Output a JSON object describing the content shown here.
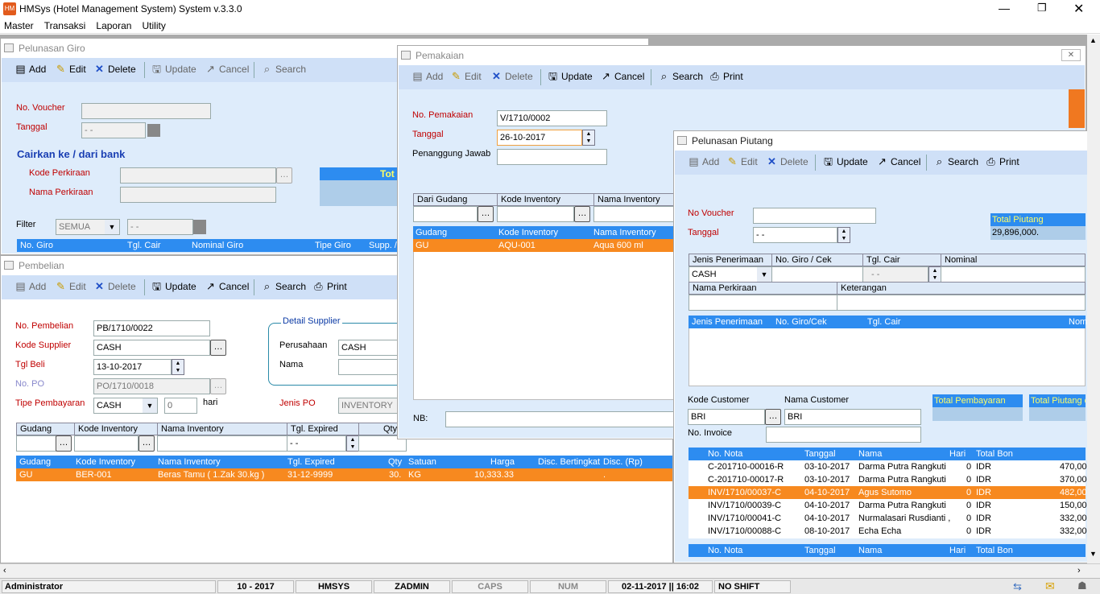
{
  "app": {
    "title": "HMSys (Hotel Management System) System v.3.3.0",
    "menu": [
      "Master",
      "Transaksi",
      "Laporan",
      "Utility"
    ]
  },
  "toolbar_common": {
    "add": "Add",
    "edit": "Edit",
    "delete": "Delete",
    "update": "Update",
    "cancel": "Cancel",
    "search": "Search",
    "print": "Print"
  },
  "giro": {
    "title": "Pelunasan Giro",
    "no_voucher_label": "No. Voucher",
    "tanggal_label": "Tanggal",
    "tanggal_value": "- -",
    "section": "Cairkan ke / dari bank",
    "kode_perkiraan_label": "Kode Perkiraan",
    "nama_perkiraan_label": "Nama Perkiraan",
    "tot_label": "Tot",
    "filter_label": "Filter",
    "filter_value": "SEMUA",
    "filter_date": "- -",
    "columns": [
      "No. Giro",
      "Tgl. Cair",
      "Nominal Giro",
      "Tipe Giro",
      "Supp. /"
    ]
  },
  "pembelian": {
    "title": "Pembelian",
    "no_pembelian_label": "No. Pembelian",
    "no_pembelian": "PB/1710/0022",
    "kode_supplier_label": "Kode Supplier",
    "kode_supplier": "CASH",
    "tgl_beli_label": "Tgl Beli",
    "tgl_beli": "13-10-2017",
    "no_po_label": "No. PO",
    "no_po": "PO/1710/0018",
    "tipe_bayar_label": "Tipe Pembayaran",
    "tipe_bayar": "CASH",
    "hari_value": "0",
    "hari_label": "hari",
    "detail_supplier": "Detail Supplier",
    "perusahaan_label": "Perusahaan",
    "perusahaan": "CASH",
    "nama_label": "Nama",
    "jenis_po_label": "Jenis PO",
    "jenis_po": "INVENTORY",
    "input_cols": [
      "Gudang",
      "Kode Inventory",
      "Nama Inventory",
      "Tgl. Expired",
      "Qty"
    ],
    "tgl_expired_value": "- -",
    "columns": [
      "Gudang",
      "Kode Inventory",
      "Nama Inventory",
      "Tgl. Expired",
      "Qty",
      "Satuan",
      "Harga",
      "Disc. Bertingkat",
      "Disc. (Rp)"
    ],
    "rows": [
      [
        "GU",
        "BER-001",
        "Beras Tamu ( 1.Zak 30.kg )",
        "31-12-9999",
        "30.",
        "KG",
        "10,333.33",
        "",
        "."
      ]
    ]
  },
  "pemakaian": {
    "title": "Pemakaian",
    "no_label": "No. Pemakaian",
    "no_value": "V/1710/0002",
    "tanggal_label": "Tanggal",
    "tanggal_value": "26-10-2017",
    "pj_label": "Penanggung Jawab",
    "input_cols": [
      "Dari Gudang",
      "Kode Inventory",
      "Nama Inventory"
    ],
    "columns": [
      "Gudang",
      "Kode Inventory",
      "Nama Inventory"
    ],
    "rows": [
      [
        "GU",
        "AQU-001",
        "Aqua 600 ml"
      ]
    ],
    "nb_label": "NB:"
  },
  "piutang": {
    "title": "Pelunasan Piutang",
    "no_voucher_label": "No Voucher",
    "tanggal_label": "Tanggal",
    "tanggal_value": "- -",
    "total_piutang_label": "Total Piutang",
    "total_piutang": "29,896,000.",
    "input_cols": [
      "Jenis Penerimaan",
      "No. Giro / Cek",
      "Tgl. Cair",
      "Nominal"
    ],
    "jenis_value": "CASH",
    "tgl_cair_value": "- -",
    "nama_perkiraan_label": "Nama Perkiraan",
    "keterangan_label": "Keterangan",
    "grid1_cols": [
      "Jenis Penerimaan",
      "No. Giro/Cek",
      "Tgl. Cair",
      "Nom"
    ],
    "kode_customer_label": "Kode Customer",
    "kode_customer": "BRI",
    "nama_customer_label": "Nama Customer",
    "nama_customer": "BRI",
    "total_pembayaran_label": "Total Pembayaran",
    "total_piutang2_label": "Total Piutang c",
    "no_invoice_label": "No. Invoice",
    "nota_cols": [
      "No. Nota",
      "Tanggal",
      "Nama",
      "Hari",
      "Total Bon"
    ],
    "nota_rows": [
      [
        "C-201710-00016-R",
        "03-10-2017",
        "Darma Putra Rangkuti",
        "0",
        "IDR",
        "470,00"
      ],
      [
        "C-201710-00017-R",
        "03-10-2017",
        "Darma Putra Rangkuti",
        "0",
        "IDR",
        "370,00"
      ],
      [
        "INV/1710/00037-C",
        "04-10-2017",
        "Agus Sutomo",
        "0",
        "IDR",
        "482,00"
      ],
      [
        "INV/1710/00039-C",
        "04-10-2017",
        "Darma Putra Rangkuti",
        "0",
        "IDR",
        "150,00"
      ],
      [
        "INV/1710/00041-C",
        "04-10-2017",
        "Nurmalasari Rusdianti ,",
        "0",
        "IDR",
        "332,00"
      ],
      [
        "INV/1710/00088-C",
        "08-10-2017",
        "Echa Echa",
        "0",
        "IDR",
        "332,00"
      ]
    ]
  },
  "status": {
    "user": "Administrator",
    "period": "10 - 2017",
    "db": "HMSYS",
    "login": "ZADMIN",
    "caps": "CAPS",
    "num": "NUM",
    "datetime": "02-11-2017 || 16:02",
    "shift": "NO SHIFT"
  },
  "colors": {
    "accent": "#2d8cf0",
    "selected": "#f7891f",
    "panel": "#deecfb"
  }
}
